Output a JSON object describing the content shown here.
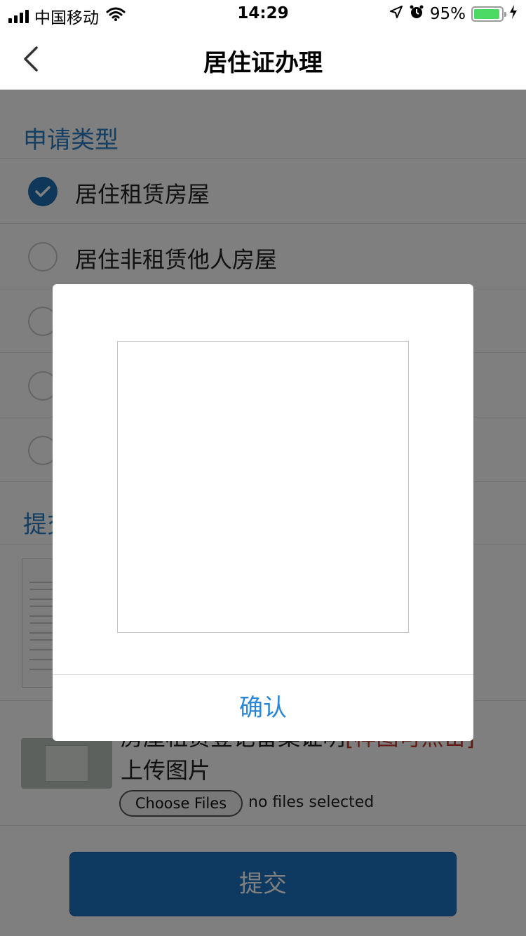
{
  "status_bar": {
    "carrier": "中国移动",
    "time": "14:29",
    "battery_percent": "95%",
    "battery_level": 0.95,
    "icons": [
      "signal-icon",
      "wifi-icon",
      "location-icon",
      "alarm-icon",
      "battery-icon",
      "charging-icon"
    ]
  },
  "nav": {
    "title": "居住证办理",
    "back_icon": "chevron-left-icon"
  },
  "application_type": {
    "title": "申请类型",
    "options": [
      {
        "label": "居住租赁房屋",
        "checked": true
      },
      {
        "label": "居住非租赁他人房屋",
        "checked": false
      }
    ]
  },
  "submit_section": {
    "title_visible": "提交"
  },
  "upload": {
    "desc_visible": "房屋租赁登记备案证明",
    "hint_visible": "[样图可点击]",
    "label": "上传图片",
    "choose_button": "Choose Files",
    "no_file_text": "no files selected"
  },
  "submit_button": "提交",
  "dialog": {
    "confirm_label": "确认"
  },
  "colors": {
    "accent_blue": "#2b7fc4",
    "button_blue": "#1d72c1",
    "confirm_blue": "#2a86d6",
    "hint_red": "#c0392b",
    "overlay": "rgba(0,0,0,0.5)"
  }
}
